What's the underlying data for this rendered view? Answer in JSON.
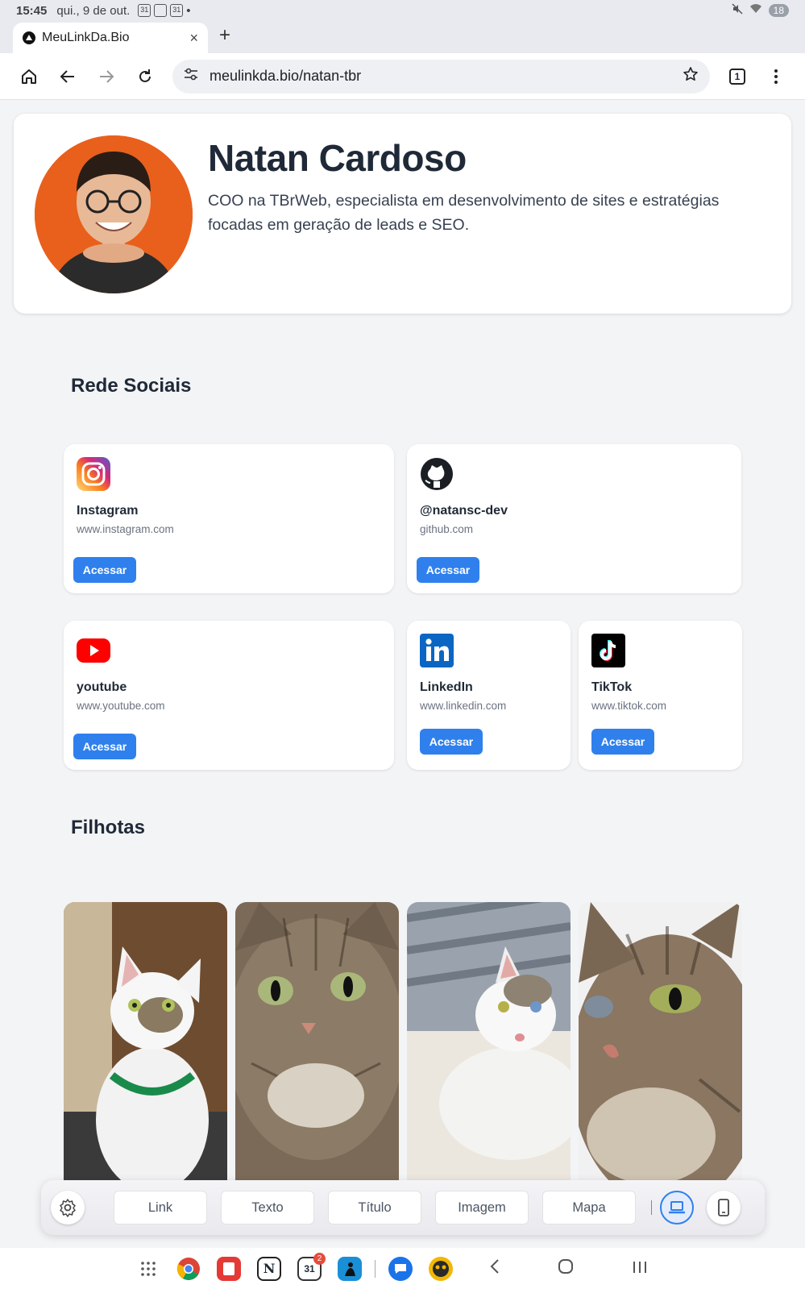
{
  "status_bar": {
    "time": "15:45",
    "date": "qui., 9 de out.",
    "notif_icon": "31",
    "battery": "18"
  },
  "browser": {
    "tab_title": "MeuLinkDa.Bio",
    "tab_close": "×",
    "new_tab": "+",
    "url": "meulinkda.bio/natan-tbr",
    "tab_count": "1"
  },
  "profile": {
    "name": "Natan Cardoso",
    "bio": "COO na TBrWeb, especialista em desenvolvimento de sites e estratégias focadas em geração de leads e SEO."
  },
  "sections": {
    "social_title": "Rede Sociais",
    "pets_title": "Filhotas"
  },
  "social_links": [
    {
      "title": "Instagram",
      "url": "www.instagram.com",
      "button": "Acessar",
      "icon": "instagram-icon"
    },
    {
      "title": "@natansc-dev",
      "url": "github.com",
      "button": "Acessar",
      "icon": "github-icon"
    },
    {
      "title": "youtube",
      "url": "www.youtube.com",
      "button": "Acessar",
      "icon": "youtube-icon"
    },
    {
      "title": "LinkedIn",
      "url": "www.linkedin.com",
      "button": "Acessar",
      "icon": "linkedin-icon"
    },
    {
      "title": "TikTok",
      "url": "www.tiktok.com",
      "button": "Acessar",
      "icon": "tiktok-icon"
    }
  ],
  "editor_toolbar": {
    "buttons": [
      "Link",
      "Texto",
      "Título",
      "Imagem",
      "Mapa"
    ]
  },
  "nav": {
    "calendar_badge": "2"
  },
  "colors": {
    "accent": "#2f80ed",
    "page_bg": "#f3f4f6",
    "avatar_bg": "#e8601c"
  }
}
